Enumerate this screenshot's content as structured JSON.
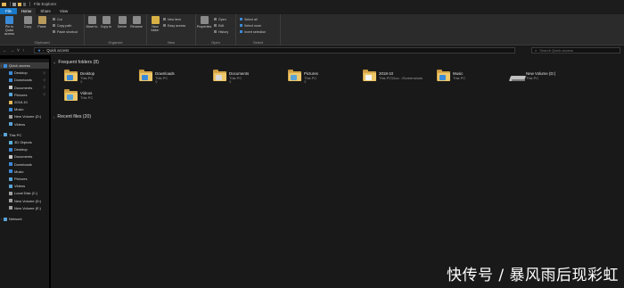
{
  "window": {
    "title": "File Explorer"
  },
  "tabs": [
    "File",
    "Home",
    "Share",
    "View"
  ],
  "ribbon": {
    "clipboard": {
      "label": "Clipboard",
      "pin": "Pin to Quick access",
      "copy": "Copy",
      "paste": "Paste",
      "cut": "Cut",
      "copy_path": "Copy path",
      "paste_shortcut": "Paste shortcut"
    },
    "organize": {
      "label": "Organize",
      "move_to": "Move to",
      "copy_to": "Copy to",
      "delete": "Delete",
      "rename": "Rename"
    },
    "new": {
      "label": "New",
      "new_folder": "New folder",
      "new_item": "New item",
      "easy_access": "Easy access"
    },
    "open": {
      "label": "Open",
      "properties": "Properties",
      "open": "Open",
      "edit": "Edit",
      "history": "History"
    },
    "select": {
      "label": "Select",
      "select_all": "Select all",
      "select_none": "Select none",
      "invert_selection": "Invert selection"
    }
  },
  "address": {
    "path": "Quick access",
    "search_placeholder": "Search Quick access"
  },
  "nav": [
    {
      "label": "Quick access",
      "icon": "star-icon",
      "color": "#3b8ad8",
      "selected": true,
      "indent": 0
    },
    {
      "label": "Desktop",
      "icon": "desktop-icon",
      "color": "#3b8ad8",
      "indent": 1,
      "pinned": true
    },
    {
      "label": "Downloads",
      "icon": "download-icon",
      "color": "#3b8ad8",
      "indent": 1,
      "pinned": true
    },
    {
      "label": "Documents",
      "icon": "documents-icon",
      "color": "#c9c9c9",
      "indent": 1,
      "pinned": true
    },
    {
      "label": "Pictures",
      "icon": "pictures-icon",
      "color": "#5aa3d8",
      "indent": 1,
      "pinned": true
    },
    {
      "label": "2018-10",
      "icon": "folder-icon",
      "color": "#e2b658",
      "indent": 1
    },
    {
      "label": "Music",
      "icon": "music-icon",
      "color": "#3b8ad8",
      "indent": 1
    },
    {
      "label": "New Volume (D:)",
      "icon": "drive-icon",
      "color": "#a0a0a0",
      "indent": 1
    },
    {
      "label": "Videos",
      "icon": "videos-icon",
      "color": "#5aa3d8",
      "indent": 1
    },
    {
      "label": "This PC",
      "icon": "computer-icon",
      "color": "#5aa3d8",
      "indent": 0,
      "gap": true
    },
    {
      "label": "3D Objects",
      "icon": "3d-objects-icon",
      "color": "#5ab0d8",
      "indent": 1
    },
    {
      "label": "Desktop",
      "icon": "desktop-icon",
      "color": "#3b8ad8",
      "indent": 1
    },
    {
      "label": "Documents",
      "icon": "documents-icon",
      "color": "#c9c9c9",
      "indent": 1
    },
    {
      "label": "Downloads",
      "icon": "download-icon",
      "color": "#3b8ad8",
      "indent": 1
    },
    {
      "label": "Music",
      "icon": "music-icon",
      "color": "#3b8ad8",
      "indent": 1
    },
    {
      "label": "Pictures",
      "icon": "pictures-icon",
      "color": "#5aa3d8",
      "indent": 1
    },
    {
      "label": "Videos",
      "icon": "videos-icon",
      "color": "#5aa3d8",
      "indent": 1
    },
    {
      "label": "Local Disk (C:)",
      "icon": "drive-icon",
      "color": "#a0a0a0",
      "indent": 1
    },
    {
      "label": "New Volume (D:)",
      "icon": "drive-icon",
      "color": "#a0a0a0",
      "indent": 1
    },
    {
      "label": "New Volume (E:)",
      "icon": "drive-icon",
      "color": "#a0a0a0",
      "indent": 1
    },
    {
      "label": "Network",
      "icon": "network-icon",
      "color": "#5aa3d8",
      "indent": 0,
      "gap": true
    }
  ],
  "frequent": {
    "header": "Frequent folders (8)",
    "items": [
      {
        "name": "Desktop",
        "location": "This PC",
        "type": "desktop",
        "badge": "#3b8ad8",
        "pinned": true
      },
      {
        "name": "Downloads",
        "location": "This PC",
        "type": "downloads",
        "badge": "#3b8ad8",
        "pinned": true
      },
      {
        "name": "Documents",
        "location": "This PC",
        "type": "documents",
        "badge": "#d9d9d9",
        "pinned": true
      },
      {
        "name": "Pictures",
        "location": "This PC",
        "type": "pictures",
        "badge": "#5aa3d8",
        "pinned": true
      },
      {
        "name": "2018-10",
        "location": "This PC\\Doc...\\Screenshots",
        "type": "folder",
        "badge": "#f5f5f5"
      },
      {
        "name": "Music",
        "location": "This PC",
        "type": "music",
        "badge": "#3b8ad8"
      },
      {
        "name": "New Volume (D:)",
        "location": "This PC",
        "type": "drive"
      },
      {
        "name": "Videos",
        "location": "This PC",
        "type": "videos",
        "badge": "#5aa3d8"
      }
    ]
  },
  "recent": {
    "header": "Recent files (20)"
  },
  "watermark": "快传号 / 暴风雨后现彩虹",
  "colors": {
    "accent": "#1979ca",
    "folder": "#eec768",
    "background": "#191919"
  }
}
